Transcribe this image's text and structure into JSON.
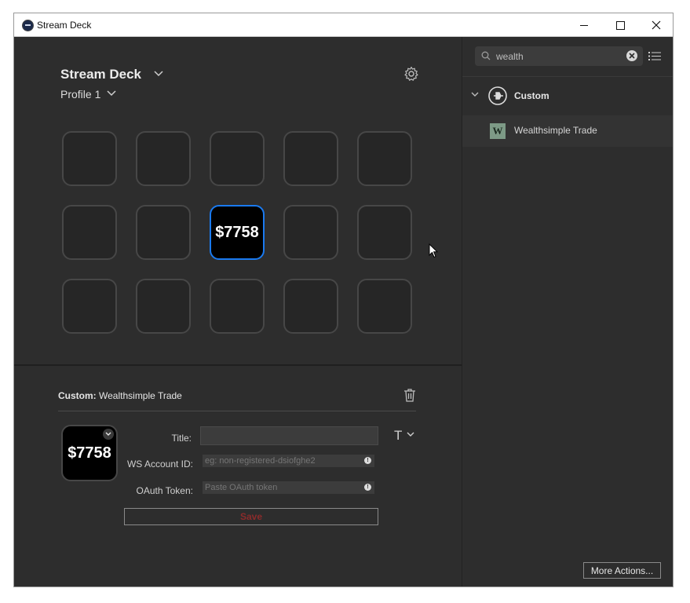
{
  "window": {
    "title": "Stream Deck"
  },
  "deck": {
    "name": "Stream Deck",
    "profile": "Profile 1"
  },
  "keys": [
    "",
    "",
    "",
    "",
    "",
    "",
    "",
    "$7758",
    "",
    "",
    "",
    "",
    "",
    "",
    ""
  ],
  "inspector": {
    "category": "Custom:",
    "action_name": "Wealthsimple Trade",
    "preview_value": "$7758",
    "title_label": "Title:",
    "title_value": "",
    "account_label": "WS Account ID:",
    "account_placeholder": "eg: non-registered-dsiofghe2",
    "token_label": "OAuth Token:",
    "token_placeholder": "Paste OAuth token",
    "font_glyph": "T",
    "info_glyph": "!",
    "save_label": "Save"
  },
  "actions_panel": {
    "search_value": "wealth",
    "category_label": "Custom",
    "action_icon_letter": "W",
    "action_label": "Wealthsimple Trade",
    "more_label": "More Actions..."
  },
  "colors": {
    "accent": "#1a7af0",
    "background": "#2d2d2d",
    "save_text": "#8b2b2b",
    "action_icon": "#7d9a86"
  }
}
